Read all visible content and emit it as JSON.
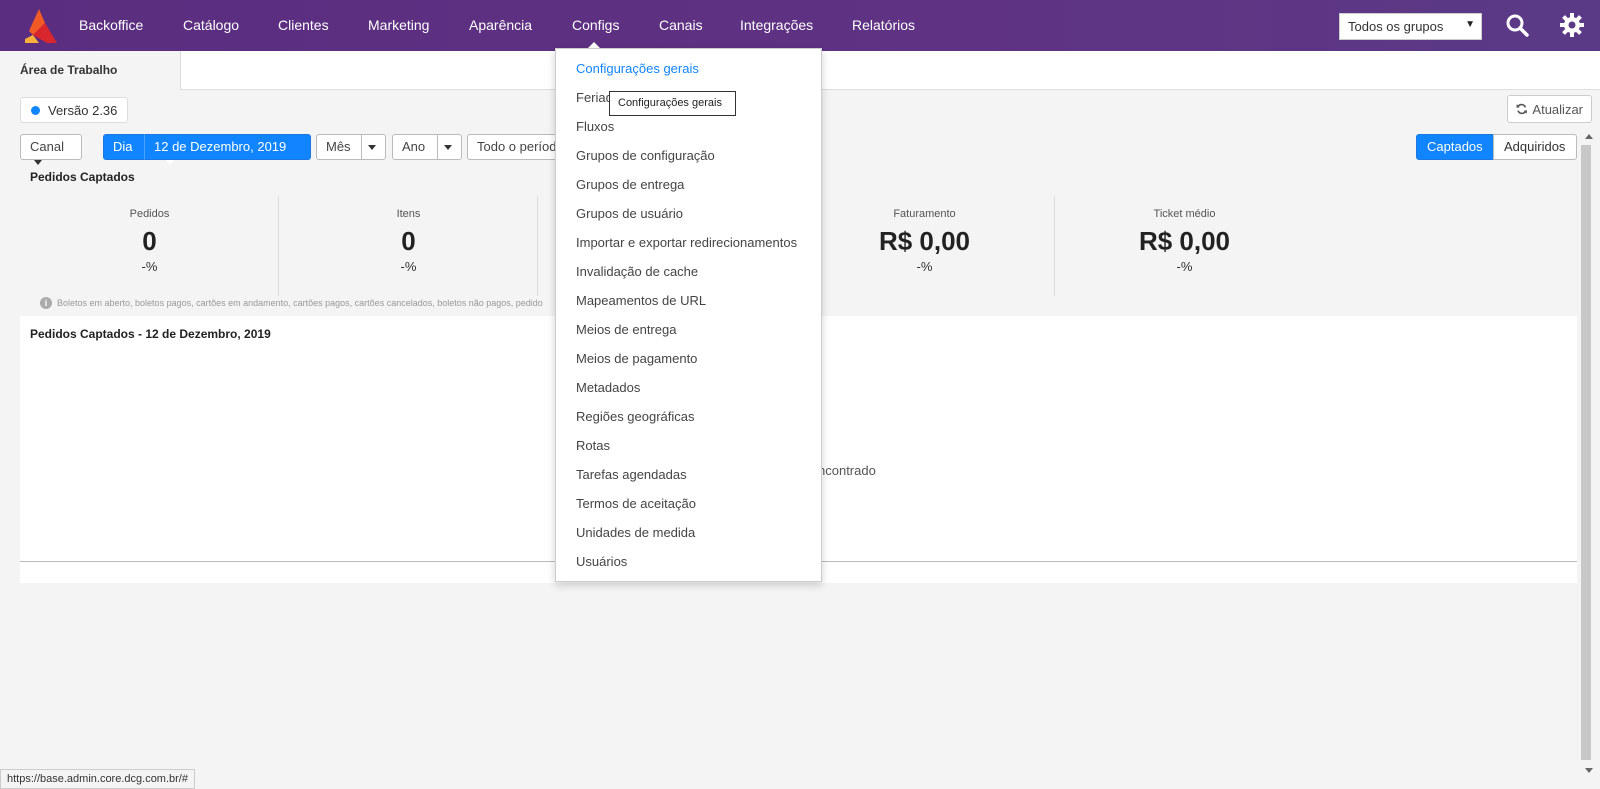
{
  "nav": {
    "items": [
      "Backoffice",
      "Catálogo",
      "Clientes",
      "Marketing",
      "Aparência",
      "Configs",
      "Canais",
      "Integrações",
      "Relatórios"
    ],
    "group_select": "Todos os grupos"
  },
  "tabs": {
    "active": "Área de Trabalho"
  },
  "version": "Versão 2.36",
  "refresh_label": "Atualizar",
  "filters": {
    "channel": "Canal",
    "day": "Dia",
    "date": "12 de Dezembro, 2019",
    "month": "Mês",
    "year": "Ano",
    "period": "Todo o períod",
    "captured": "Captados",
    "acquired": "Adquiridos"
  },
  "summary": {
    "title": "Pedidos Captados",
    "metrics": [
      {
        "label": "Pedidos",
        "value": "0",
        "pct": "-%"
      },
      {
        "label": "Itens",
        "value": "0",
        "pct": "-%"
      },
      {
        "label": "Faturamento",
        "value": "R$ 0,00",
        "pct": "-%"
      },
      {
        "label": "Ticket médio",
        "value": "R$ 0,00",
        "pct": "-%"
      }
    ],
    "note": "Boletos em aberto, boletos pagos, cartões em andamento, cartões pagos, cartões cancelados, boletos não pagos, pedido"
  },
  "chart": {
    "title": "Pedidos Captados - 12 de Dezembro, 2019",
    "empty_text": "ncontrado"
  },
  "dropdown": {
    "items": [
      "Configurações gerais",
      "Feriad",
      "Fluxos",
      "Grupos de configuração",
      "Grupos de entrega",
      "Grupos de usuário",
      "Importar e exportar redirecionamentos",
      "Invalidação de cache",
      "Mapeamentos de URL",
      "Meios de entrega",
      "Meios de pagamento",
      "Metadados",
      "Regiões geográficas",
      "Rotas",
      "Tarefas agendadas",
      "Termos de aceitação",
      "Unidades de medida",
      "Usuários"
    ],
    "tooltip": "Configurações gerais"
  },
  "status_url": "https://base.admin.core.dcg.com.br/#",
  "colors": {
    "nav_bg": "#5b2d80",
    "accent": "#1185ff"
  }
}
